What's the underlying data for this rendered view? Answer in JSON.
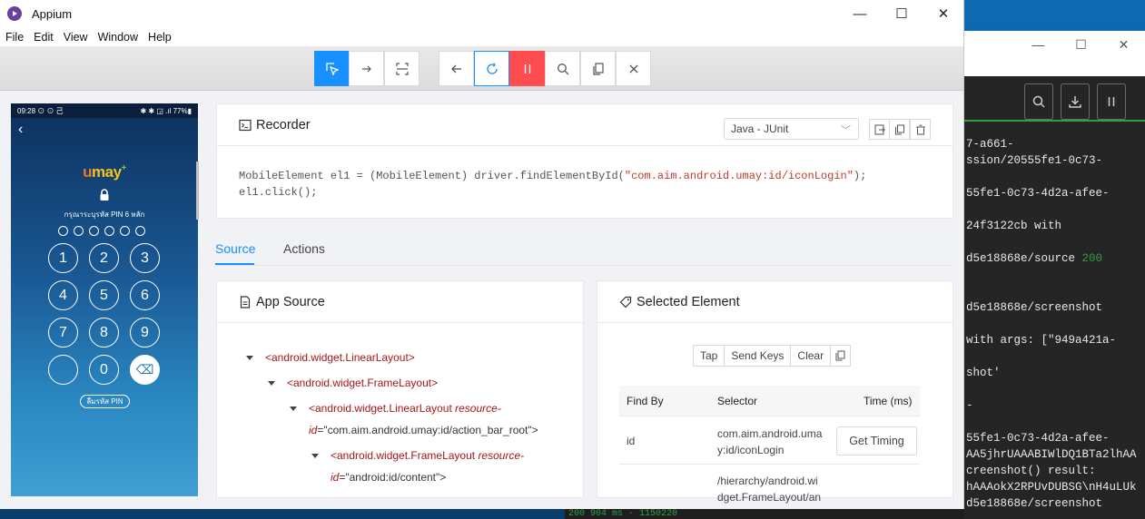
{
  "window": {
    "title": "Appium",
    "minimize": "—",
    "maximize": "☐",
    "close": "✕"
  },
  "menu": [
    "File",
    "Edit",
    "View",
    "Window",
    "Help"
  ],
  "toolbar": {
    "active_color": "#1890ff",
    "pause_color": "#ff4d4f"
  },
  "phone": {
    "status_left": "09:28 ⊙ ⊙ 己",
    "status_right": "✱ ✱ ◲ .ıl 77%▮",
    "logo_u": "u",
    "logo_rest": "may",
    "pin_prompt": "กรุณาระบุรหัส PIN 6 หลัก",
    "keys": [
      "1",
      "2",
      "3",
      "4",
      "5",
      "6",
      "7",
      "8",
      "9",
      "",
      "0",
      "⌫"
    ],
    "forgot_pin": "ลืมรหัส PIN"
  },
  "recorder": {
    "title": "Recorder",
    "language": "Java - JUnit",
    "code_line1_prefix": "MobileElement el1 = (MobileElement) driver.findElementById(",
    "code_line1_string": "\"com.aim.android.umay:id/iconLogin\"",
    "code_line1_suffix": ");",
    "code_line2": "el1.click();"
  },
  "tabs": {
    "source": "Source",
    "actions": "Actions"
  },
  "app_source": {
    "title": "App Source",
    "nodes": [
      {
        "tag": "<android.widget.LinearLayout>"
      },
      {
        "tag": "<android.widget.FrameLayout>"
      },
      {
        "tag": "<android.widget.LinearLayout",
        "attr": "resource-",
        "attr2": "id",
        "value": "=\"com.aim.android.umay:id/action_bar_root\">"
      },
      {
        "tag": "<android.widget.FrameLayout",
        "attr": "resource-",
        "attr2": "id",
        "value": "=\"android:id/content\">"
      }
    ]
  },
  "selected_element": {
    "title": "Selected Element",
    "actions": [
      "Tap",
      "Send Keys",
      "Clear"
    ],
    "table_headers": {
      "find_by": "Find By",
      "selector": "Selector",
      "time": "Time (ms)"
    },
    "rows": [
      {
        "find_by": "id",
        "selector_l1": "com.aim.android.uma",
        "selector_l2": "y:id/iconLogin",
        "action": "Get Timing"
      },
      {
        "find_by": "",
        "selector_l1": "/hierarchy/android.wi",
        "selector_l2": "dget.FrameLayout/an"
      }
    ]
  },
  "terminal": {
    "lines": [
      "7-a661-",
      "ssion/20555fe1-0c73-",
      "",
      "55fe1-0c73-4d2a-afee-",
      "",
      "24f3122cb with",
      "",
      "d5e18868e/source ",
      "",
      "",
      "d5e18868e/screenshot",
      "",
      "with args: [\"949a421a-",
      "",
      "shot'",
      "",
      "-",
      "",
      "55fe1-0c73-4d2a-afee-",
      "AA5jhrUAAABIWlDQ1BTa2lhAA",
      "creenshot() result:",
      "hAAAokX2RPUvDUBSG\\nH4uLUk",
      "d5e18868e/screenshot"
    ],
    "status_200": "200",
    "bottom_strip": "200 904 ms - 1150220"
  }
}
